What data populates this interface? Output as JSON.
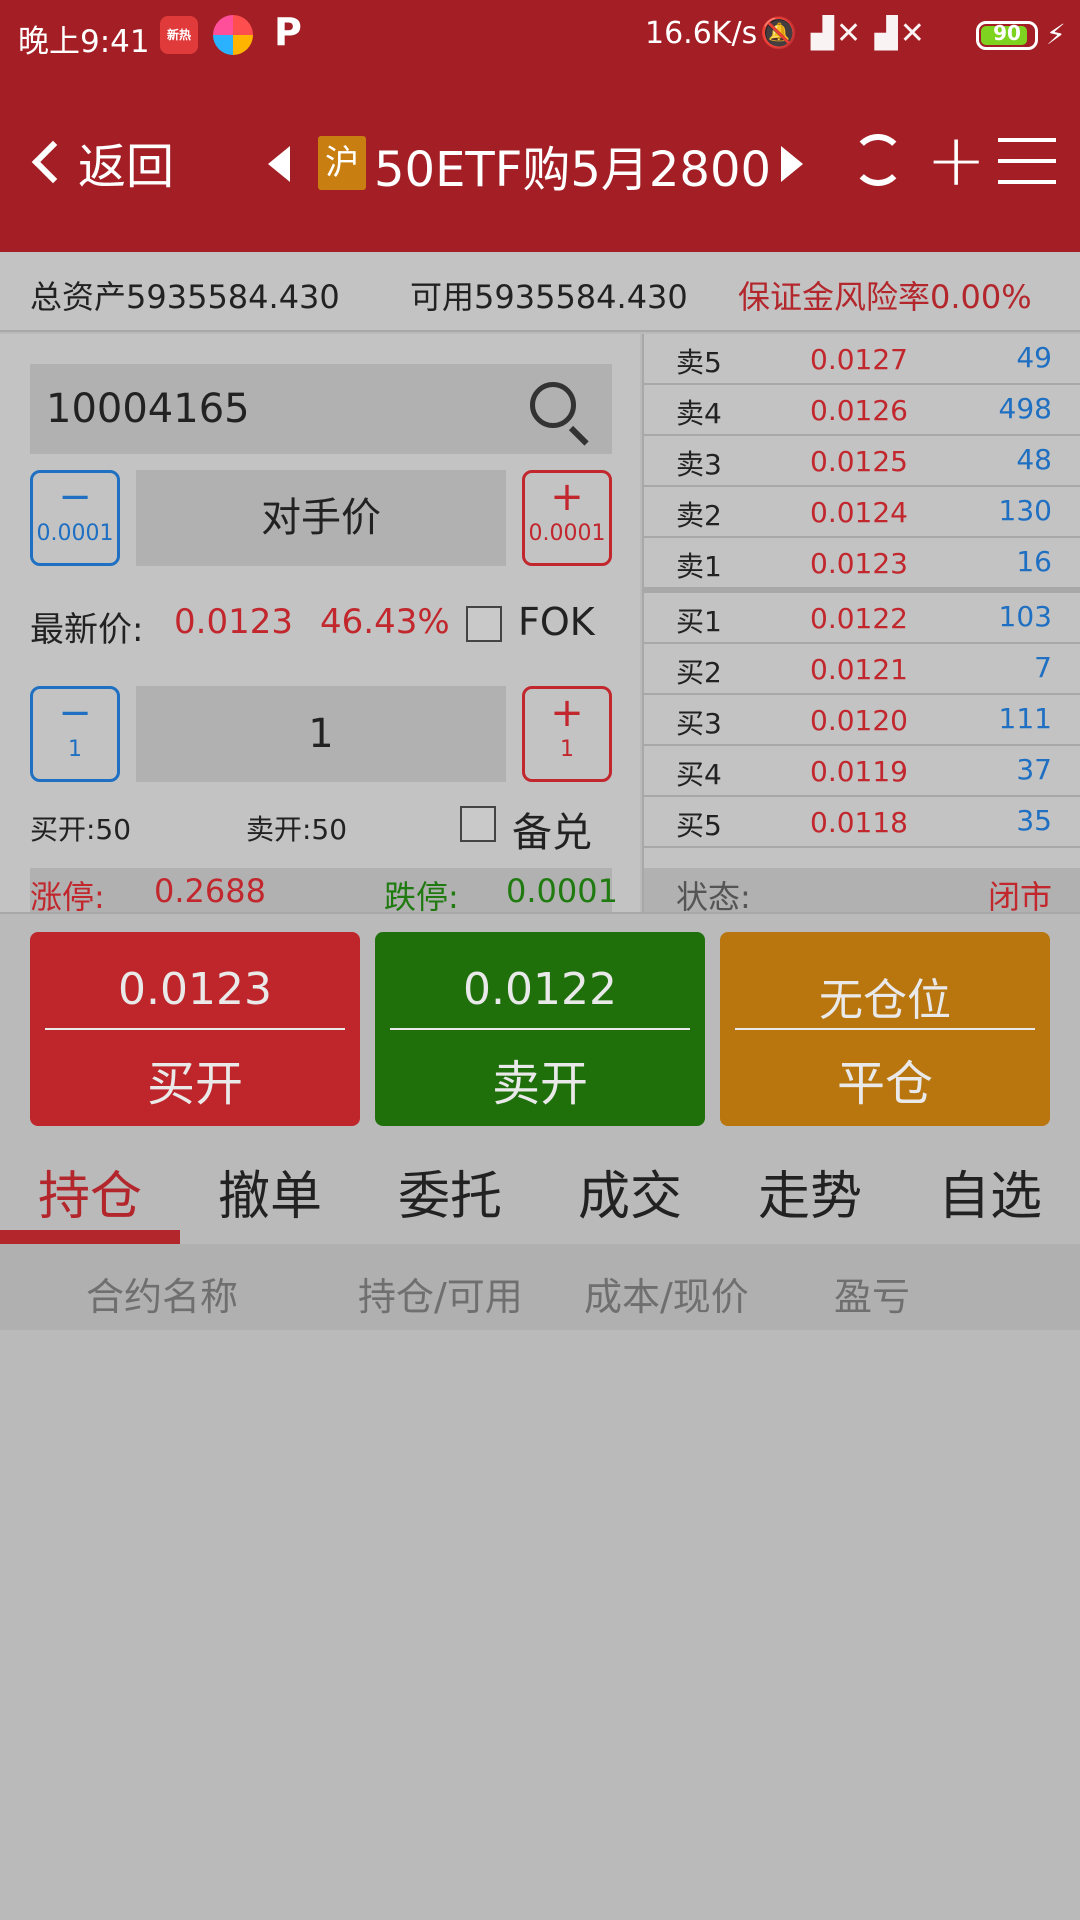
{
  "status_bar": {
    "time": "晚上9:41",
    "app1_label": "新热",
    "app3_label": "P",
    "net_speed": "16.6K/s",
    "icons": "🔕 ▟✕ ▟✕",
    "battery": "90"
  },
  "header": {
    "back_label": "返回",
    "exchange_badge": "沪",
    "title": "50ETF购5月2800"
  },
  "account": {
    "total_assets": "总资产5935584.430",
    "available": "可用5935584.430",
    "margin_risk": "保证金风险率0.00%"
  },
  "order_form": {
    "contract_code": "10004165",
    "price_minus_step": "0.0001",
    "price_plus_step": "0.0001",
    "price_mode": "对手价",
    "latest_label": "最新价:",
    "latest_price": "0.0123",
    "latest_change": "46.43%",
    "fok_label": "FOK",
    "qty_minus_step": "1",
    "qty_plus_step": "1",
    "quantity": "1",
    "open_buy": "买开:50",
    "open_sell": "卖开:50",
    "covered_label": "备兑",
    "limit_up_label": "涨停:",
    "limit_up_value": "0.2688",
    "limit_down_label": "跌停:",
    "limit_down_value": "0.0001"
  },
  "order_book": {
    "rows": [
      {
        "label": "卖5",
        "price": "0.0127",
        "volume": "49"
      },
      {
        "label": "卖4",
        "price": "0.0126",
        "volume": "498"
      },
      {
        "label": "卖3",
        "price": "0.0125",
        "volume": "48"
      },
      {
        "label": "卖2",
        "price": "0.0124",
        "volume": "130"
      },
      {
        "label": "卖1",
        "price": "0.0123",
        "volume": "16"
      },
      {
        "label": "买1",
        "price": "0.0122",
        "volume": "103"
      },
      {
        "label": "买2",
        "price": "0.0121",
        "volume": "7"
      },
      {
        "label": "买3",
        "price": "0.0120",
        "volume": "111"
      },
      {
        "label": "买4",
        "price": "0.0119",
        "volume": "37"
      },
      {
        "label": "买5",
        "price": "0.0118",
        "volume": "35"
      }
    ],
    "status_label": "状态:",
    "status_value": "闭市"
  },
  "actions": {
    "buy_price": "0.0123",
    "buy_label": "买开",
    "sell_price": "0.0122",
    "sell_label": "卖开",
    "close_price": "无仓位",
    "close_label": "平仓"
  },
  "tabs": [
    "持仓",
    "撤单",
    "委托",
    "成交",
    "走势",
    "自选"
  ],
  "positions_header": [
    "合约名称",
    "持仓/可用",
    "成本/现价",
    "盈亏"
  ],
  "colors": {
    "brand_red": "#a31f25",
    "up_red": "#c1272d",
    "down_green": "#1f6f0b",
    "accent_blue": "#1f6fc2",
    "close_orange": "#b9760e"
  }
}
